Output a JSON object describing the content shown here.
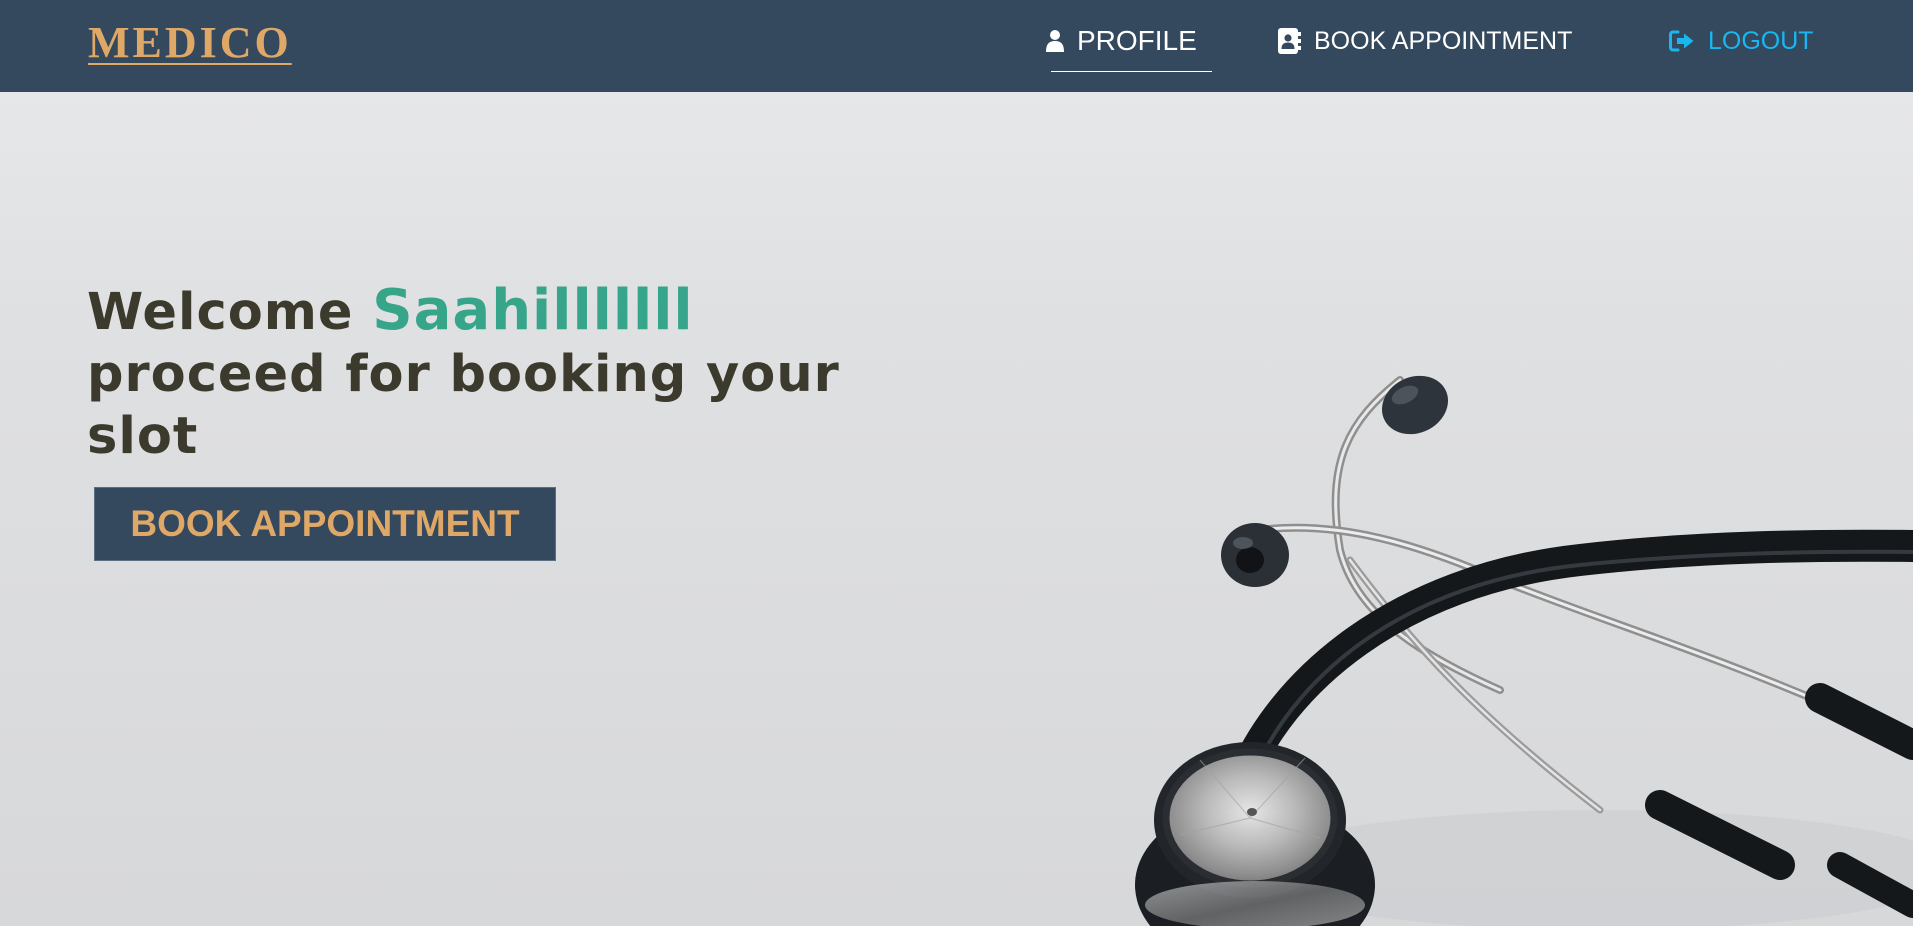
{
  "brand": {
    "name": "MEDICO"
  },
  "nav": {
    "profile_label": "PROFILE",
    "book_label": "BOOK APPOINTMENT",
    "logout_label": "LOGOUT",
    "profile_icon": "user-icon",
    "book_icon": "address-book-icon",
    "logout_icon": "sign-out-icon"
  },
  "hero": {
    "welcome": "Welcome",
    "user_name": "Saahilllllll",
    "tagline": "proceed for booking your slot",
    "button_label": "BOOK APPOINTMENT"
  },
  "colors": {
    "navbar_bg": "#34495e",
    "brand": "#e0a866",
    "accent_name": "#36a58a",
    "logout": "#18b7f0",
    "heading": "#3b3a2c"
  }
}
